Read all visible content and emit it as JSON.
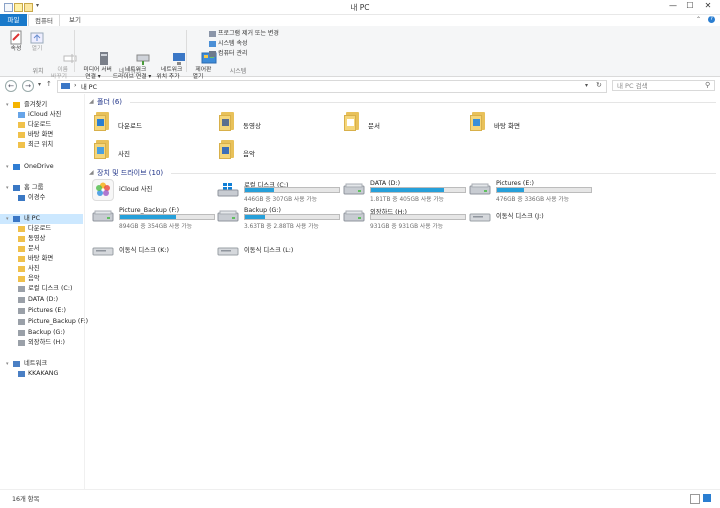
{
  "window": {
    "title": "내 PC",
    "controls": [
      "—",
      "☐",
      "✕"
    ]
  },
  "tabs": [
    "파일",
    "컴퓨터",
    "보기"
  ],
  "ribbon": {
    "location": {
      "properties": "속성",
      "open": "열기",
      "rename": "이름\n바꾸기",
      "label": "위치"
    },
    "network": {
      "media": "미디어 서버\n연결 ▾",
      "map": "네트워크\n드라이브 연결 ▾",
      "add": "네트워크\n위치 추가",
      "label": "네트워크"
    },
    "system": {
      "control": "제어판\n열기",
      "uninstall": "프로그램 제거 또는 변경",
      "sysprops": "시스템 속성",
      "manage": "컴퓨터 관리",
      "label": "시스템"
    }
  },
  "address": {
    "path": "내 PC",
    "search_placeholder": "내 PC 검색"
  },
  "sidebar": {
    "items": [
      {
        "label": "즐겨찾기",
        "indent": 0
      },
      {
        "label": "iCloud 사진",
        "indent": 1
      },
      {
        "label": "다운로드",
        "indent": 1
      },
      {
        "label": "바탕 화면",
        "indent": 1
      },
      {
        "label": "최근 위치",
        "indent": 1
      },
      {
        "label": "OneDrive",
        "indent": 0
      },
      {
        "label": "홈 그룹",
        "indent": 0
      },
      {
        "label": "이경수",
        "indent": 1
      },
      {
        "label": "내 PC",
        "indent": 0
      },
      {
        "label": "다운로드",
        "indent": 1
      },
      {
        "label": "동영상",
        "indent": 1
      },
      {
        "label": "문서",
        "indent": 1
      },
      {
        "label": "바탕 화면",
        "indent": 1
      },
      {
        "label": "사진",
        "indent": 1
      },
      {
        "label": "음악",
        "indent": 1
      },
      {
        "label": "로컬 디스크 (C:)",
        "indent": 1
      },
      {
        "label": "DATA (D:)",
        "indent": 1
      },
      {
        "label": "Pictures (E:)",
        "indent": 1
      },
      {
        "label": "Picture_Backup (F:)",
        "indent": 1
      },
      {
        "label": "Backup (G:)",
        "indent": 1
      },
      {
        "label": "외장하드 (H:)",
        "indent": 1
      },
      {
        "label": "네트워크",
        "indent": 0
      },
      {
        "label": "KKAKANG",
        "indent": 1
      }
    ]
  },
  "folders": {
    "header": "폴더",
    "count": "(6)",
    "items": [
      "다운로드",
      "동영상",
      "문서",
      "바탕 화면",
      "사진",
      "음악"
    ]
  },
  "drives": {
    "header": "장치 및 드라이브",
    "count": "(10)",
    "items": [
      {
        "name": "iCloud 사진",
        "type": "icloud"
      },
      {
        "name": "로컬 디스크 (C:)",
        "type": "win",
        "size": "446GB 중 307GB 사용 가능",
        "used": 0.31
      },
      {
        "name": "DATA (D:)",
        "type": "hdd",
        "size": "1.81TB 중 405GB 사용 가능",
        "used": 0.78
      },
      {
        "name": "Pictures (E:)",
        "type": "hdd",
        "size": "476GB 중 336GB 사용 가능",
        "used": 0.29
      },
      {
        "name": "Picture_Backup (F:)",
        "type": "hdd",
        "size": "894GB 중 354GB 사용 가능",
        "used": 0.6
      },
      {
        "name": "Backup (G:)",
        "type": "hdd",
        "size": "3.63TB 중 2.88TB 사용 가능",
        "used": 0.21
      },
      {
        "name": "외장하드 (H:)",
        "type": "hdd",
        "size": "931GB 중 931GB 사용 가능",
        "used": 0.0
      },
      {
        "name": "이동식 디스크 (J:)",
        "type": "removable"
      },
      {
        "name": "이동식 디스크 (K:)",
        "type": "removable"
      },
      {
        "name": "이동식 디스크 (L:)",
        "type": "removable"
      }
    ]
  },
  "status": {
    "count": "16개 항목"
  }
}
